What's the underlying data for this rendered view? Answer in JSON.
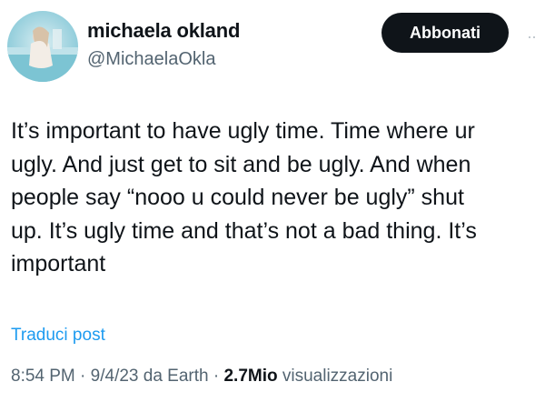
{
  "author": {
    "display_name": "michaela okland",
    "handle": "@MichaelaOkla"
  },
  "actions": {
    "follow_label": "Abbonati",
    "more_label": "··"
  },
  "tweet": {
    "lines": [
      "It’s important to have ugly time. Time where ur",
      "ugly. And just get to sit and be ugly. And when",
      "people say “nooo u could never be ugly” shut",
      "up. It’s ugly time and that’s not a bad thing. It’s",
      "important"
    ],
    "translate_label": "Traduci post",
    "time": "8:54 PM",
    "sep1": " · ",
    "date": "9/4/23",
    "source": " da Earth",
    "sep2": " · ",
    "views_count": "2.7Mio",
    "views_label": " visualizzazioni"
  },
  "colors": {
    "text": "#0f1419",
    "secondary": "#536471",
    "link": "#1d9bf0",
    "button_bg": "#0f1419"
  }
}
